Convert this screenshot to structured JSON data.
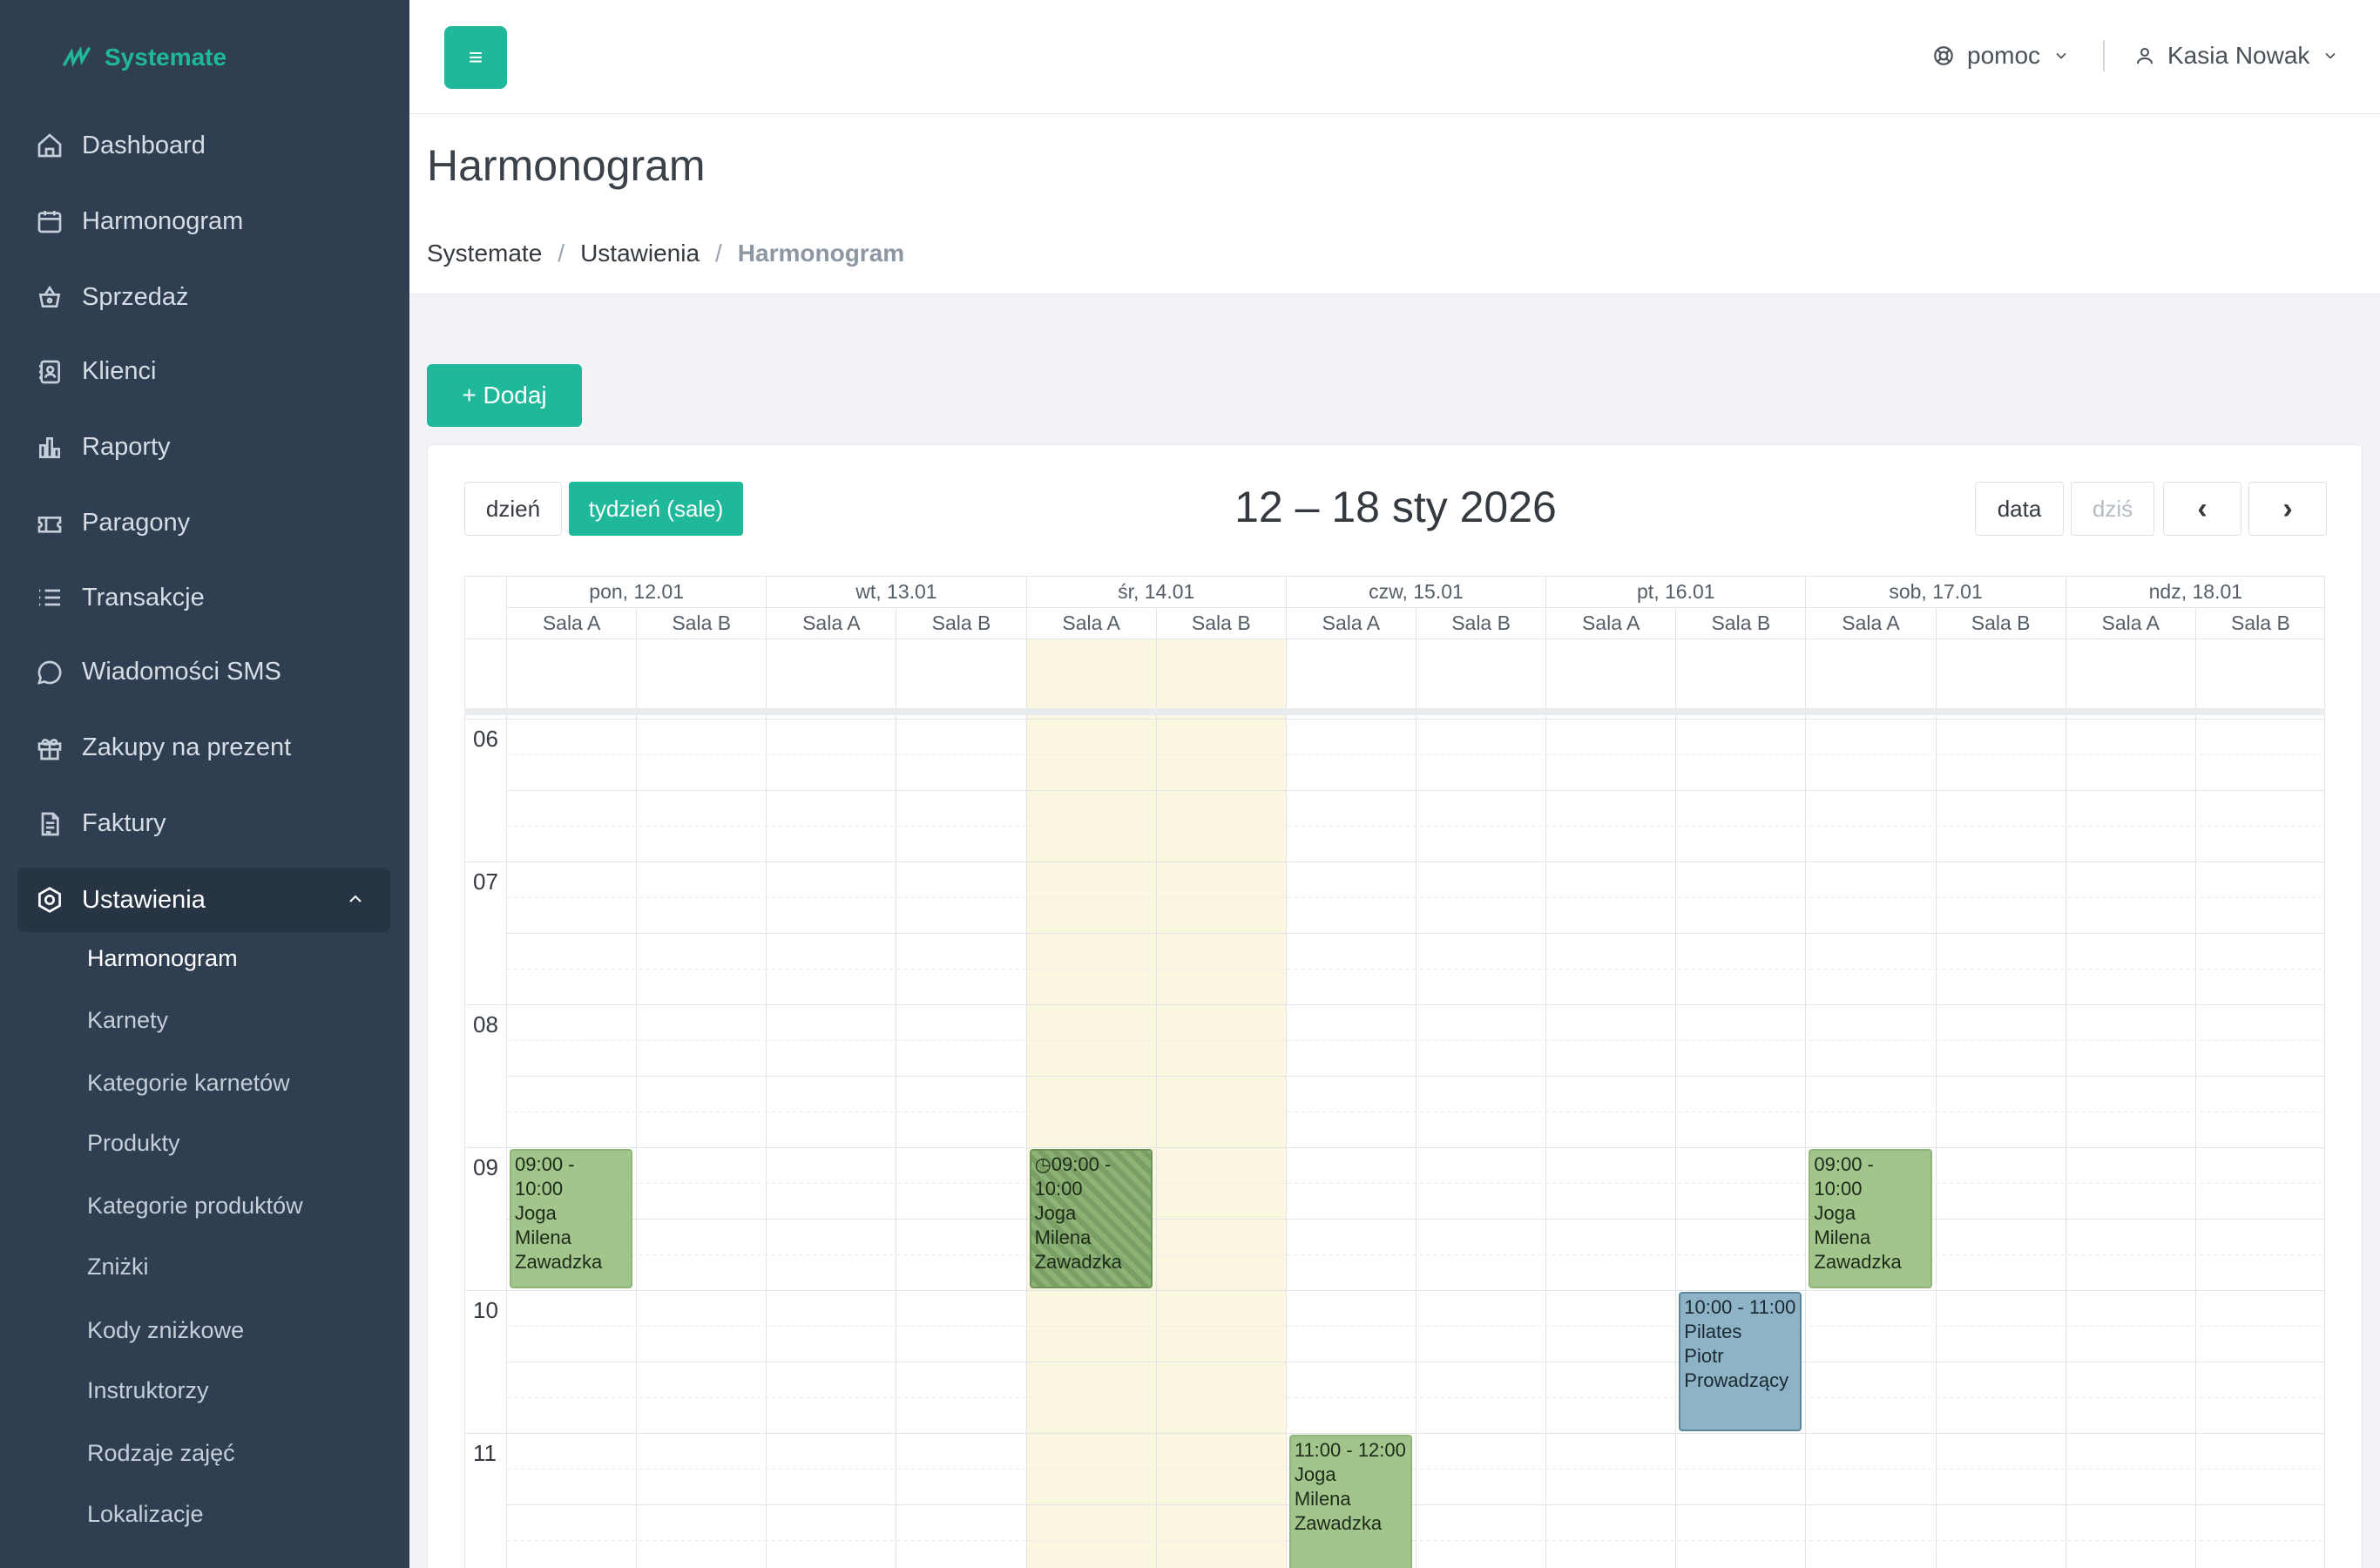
{
  "brand": {
    "name": "Systemate"
  },
  "sidebar": {
    "items": [
      {
        "label": "Dashboard",
        "icon": "home-icon"
      },
      {
        "label": "Harmonogram",
        "icon": "calendar-icon"
      },
      {
        "label": "Sprzedaż",
        "icon": "basket-icon"
      },
      {
        "label": "Klienci",
        "icon": "contacts-icon"
      },
      {
        "label": "Raporty",
        "icon": "bar-chart-icon"
      },
      {
        "label": "Paragony",
        "icon": "ticket-icon"
      },
      {
        "label": "Transakcje",
        "icon": "list-icon"
      },
      {
        "label": "Wiadomości SMS",
        "icon": "message-icon"
      },
      {
        "label": "Zakupy na prezent",
        "icon": "gift-icon"
      },
      {
        "label": "Faktury",
        "icon": "invoice-icon"
      },
      {
        "label": "Ustawienia",
        "icon": "settings-icon"
      }
    ],
    "submenu": [
      "Harmonogram",
      "Karnety",
      "Kategorie karnetów",
      "Produkty",
      "Kategorie produktów",
      "Zniżki",
      "Kody zniżkowe",
      "Instruktorzy",
      "Rodzaje zajęć",
      "Lokalizacje"
    ]
  },
  "topbar": {
    "menu_label": "≡",
    "help_label": "pomoc",
    "user_name": "Kasia Nowak"
  },
  "page": {
    "title": "Harmonogram",
    "breadcrumb": [
      "Systemate",
      "Ustawienia",
      "Harmonogram"
    ]
  },
  "add_button": "+ Dodaj",
  "calendar": {
    "view_day": "dzień",
    "view_week": "tydzień (sale)",
    "title": "12 – 18 sty 2026",
    "btn_date": "data",
    "btn_today": "dziś",
    "btn_prev": "‹",
    "btn_next": "›",
    "days": [
      "pon, 12.01",
      "wt, 13.01",
      "śr, 14.01",
      "czw, 15.01",
      "pt, 16.01",
      "sob, 17.01",
      "ndz, 18.01"
    ],
    "rooms": [
      "Sala A",
      "Sala B"
    ],
    "today_index": 2,
    "hours": [
      "06",
      "07",
      "08",
      "09",
      "10",
      "11"
    ],
    "events": [
      {
        "day": 0,
        "room": 0,
        "start": 9,
        "end": 10,
        "time": "09:00 - 10:00",
        "name": "Joga",
        "instructor": "Milena Zawadzka",
        "style": "green"
      },
      {
        "day": 2,
        "room": 0,
        "start": 9,
        "end": 10,
        "time": "09:00 - 10:00",
        "name": "Joga",
        "instructor": "Milena Zawadzka",
        "style": "hatched"
      },
      {
        "day": 5,
        "room": 0,
        "start": 9,
        "end": 10,
        "time": "09:00 - 10:00",
        "name": "Joga",
        "instructor": "Milena Zawadzka",
        "style": "green"
      },
      {
        "day": 4,
        "room": 1,
        "start": 10,
        "end": 11,
        "time": "10:00 - 11:00",
        "name": "Pilates",
        "instructor": "Piotr Prowadzący",
        "style": "blue"
      },
      {
        "day": 3,
        "room": 0,
        "start": 11,
        "end": 12,
        "time": "11:00 - 12:00",
        "name": "Joga",
        "instructor": "Milena Zawadzka",
        "style": "green"
      }
    ]
  },
  "colors": {
    "accent": "#1fb89a",
    "sidebar": "#2f3e50",
    "today": "#fbf6df"
  }
}
